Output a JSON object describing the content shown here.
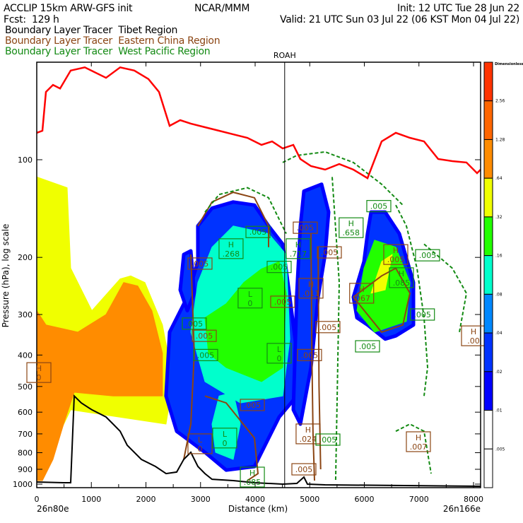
{
  "header": {
    "model": "ACCLIP 15km ARW-GFS init",
    "org": "NCAR/MMM",
    "init": "Init: 12 UTC Tue 28 Jun 22",
    "fcst": "Fcst:  129 h",
    "valid": "Valid: 21 UTC Sun 03 Jul 22 (06 KST Mon 04 Jul 22)",
    "legend": [
      {
        "label": "Boundary Layer Tracer  Tibet Region",
        "color": "#000000"
      },
      {
        "label": "Boundary Layer Tracer  Eastern China Region",
        "color": "#8B4513"
      },
      {
        "label": "Boundary Layer Tracer  West Pacific Region",
        "color": "#138a13"
      }
    ]
  },
  "chart_data": {
    "type": "cross-section",
    "xlabel": "Distance (km)",
    "ylabel": "Pressure (hPa), log scale",
    "xlim": [
      0,
      8140
    ],
    "ylim": [
      1025,
      50
    ],
    "x_ticks": [
      0,
      1000,
      2000,
      3000,
      4000,
      5000,
      6000,
      7000,
      8000
    ],
    "x_minor_ticks": [
      500,
      1500,
      2500,
      3500,
      4500,
      5500,
      6500,
      7500
    ],
    "y_ticks": [
      100,
      200,
      300,
      400,
      500,
      600,
      700,
      800,
      900,
      1000
    ],
    "left_endpoint": "26n80e",
    "right_endpoint": "26n166e",
    "marker": {
      "label": "ROAH",
      "x": 4541
    },
    "colorbar": {
      "title": "Dimensionless",
      "colors": [
        "#FF3300",
        "#FF6600",
        "#FF8C00",
        "#F0FF00",
        "#22FF00",
        "#00FFCC",
        "#0088FF",
        "#0033FF",
        "#0000FF",
        "#FFFFFF",
        "#FFFFFF"
      ],
      "labels": [
        "2.56",
        "1.28",
        ".64",
        ".32",
        ".16",
        ".08",
        ".04",
        ".02",
        ".01",
        ".005"
      ]
    },
    "tropopause_line": {
      "color": "#FF0000",
      "x": [
        0,
        104,
        168,
        298,
        427,
        621,
        880,
        1269,
        1528,
        1786,
        2045,
        2239,
        2434,
        2628,
        2822,
        3081,
        3340,
        3599,
        3858,
        4117,
        4311,
        4505,
        4699,
        4828,
        5023,
        5282,
        5540,
        5799,
        6058,
        6317,
        6576,
        6835,
        7094,
        7353,
        7612,
        7871,
        8065,
        8129
      ],
      "p": [
        82.6,
        81.4,
        61.8,
        58.8,
        60.3,
        53.1,
        51.9,
        55.9,
        51.9,
        53.1,
        56.4,
        61.8,
        78.6,
        75.5,
        77.4,
        79.4,
        81.4,
        83.5,
        85.6,
        90.0,
        87.8,
        92.3,
        90.0,
        99.5,
        104.6,
        107.3,
        103.1,
        107.3,
        114,
        87.8,
        82.6,
        85.6,
        87.8,
        99.5,
        101,
        102,
        110,
        107.3
      ]
    },
    "terrain": {
      "color": "#000000",
      "x": [
        0,
        492,
        621,
        686,
        816,
        1010,
        1269,
        1398,
        1528,
        1657,
        1916,
        2175,
        2369,
        2563,
        2693,
        2822,
        2951,
        3081,
        3210,
        3599,
        3987,
        4505,
        4764,
        4893,
        4958,
        5282,
        8129
      ],
      "p": [
        985,
        990,
        990,
        535,
        562,
        590,
        621,
        653,
        687,
        759,
        839,
        882,
        928,
        918,
        839,
        798,
        882,
        928,
        966,
        975,
        990,
        1000,
        995,
        951,
        1000,
        1005,
        1015
      ]
    },
    "shaded": [
      {
        "level": ".32",
        "color": "#F0FF00",
        "x": [
          0,
          556,
          621,
          1010,
          1527,
          1721,
          1980,
          2303,
          2497,
          2368,
          621,
          0
        ],
        "p": [
          113,
          122,
          216,
          292,
          233,
          228,
          239,
          323,
          483,
          653,
          590,
          975
        ]
      },
      {
        "level": ".64",
        "color": "#FF8C00",
        "x": [
          0,
          168,
          751,
          1268,
          1592,
          1850,
          2109,
          2303,
          2303,
          1398,
          686,
          492,
          298,
          104,
          0
        ],
        "p": [
          292,
          323,
          340,
          300,
          239,
          245,
          292,
          395,
          535,
          535,
          521,
          653,
          839,
          975,
          975
        ]
      },
      {
        "level": ".02",
        "color": "#0033FF",
        "x": [
          2950,
          3210,
          3599,
          3987,
          4246,
          4505,
          4635,
          4764,
          4764,
          4440,
          3987,
          3469,
          3081,
          2563,
          2368,
          2434,
          2757,
          2951
        ],
        "p": [
          160,
          141,
          135,
          138,
          160,
          182,
          265,
          395,
          535,
          621,
          883,
          905,
          798,
          687,
          535,
          340,
          265,
          206
        ]
      },
      {
        "level": ".02",
        "color": "#0033FF",
        "x": [
          4893,
          5217,
          5346,
          5282,
          5153,
          5023,
          4828,
          4699,
          4764,
          4828
        ],
        "p": [
          125,
          119,
          145,
          196,
          265,
          437,
          653,
          590,
          258,
          160
        ]
      },
      {
        "level": ".02",
        "color": "#0033FF",
        "x": [
          6123,
          6382,
          6641,
          6900,
          6900,
          6576,
          6382,
          6058,
          5864,
          5799,
          5994,
          6058
        ],
        "p": [
          145,
          145,
          169,
          239,
          323,
          349,
          357,
          323,
          307,
          265,
          206,
          169
        ]
      },
      {
        "level": ".02",
        "color": "#0033FF",
        "x": [
          2692,
          2822,
          2886,
          2757,
          2628
        ],
        "p": [
          196,
          191,
          258,
          292,
          252
        ]
      },
      {
        "level": ".08",
        "color": "#00FFCC",
        "x": [
          3210,
          3599,
          4246,
          4570,
          4635,
          4505,
          3728,
          3081,
          2822,
          2951
        ],
        "p": [
          186,
          160,
          169,
          196,
          357,
          535,
          562,
          483,
          340,
          239
        ]
      },
      {
        "level": ".08",
        "color": "#00FFCC",
        "x": [
          3340,
          3599,
          3728,
          3599,
          3275,
          3210
        ],
        "p": [
          535,
          521,
          653,
          839,
          798,
          653
        ]
      },
      {
        "level": ".16",
        "color": "#22FF00",
        "x": [
          3469,
          3793,
          4117,
          4440,
          4570,
          4505,
          4117,
          3469,
          3146,
          3081
        ],
        "p": [
          278,
          239,
          217,
          206,
          258,
          437,
          483,
          437,
          395,
          307
        ]
      },
      {
        "level": ".16",
        "color": "#22FF00",
        "x": [
          6188,
          6576,
          6835,
          6770,
          6188,
          5864,
          5994
        ],
        "p": [
          177,
          186,
          239,
          315,
          340,
          292,
          216
        ]
      },
      {
        "level": ".32",
        "color": "#F0FF00",
        "x": [
          6317,
          6511,
          6382,
          6123
        ],
        "p": [
          206,
          196,
          252,
          258
        ]
      }
    ],
    "east_china_contours": [
      {
        "x": [
          2950,
          3210,
          3599,
          3987,
          4246,
          4246
        ],
        "p": [
          160,
          135,
          126,
          131,
          160,
          186
        ]
      },
      {
        "x": [
          5023,
          5040,
          5060,
          5088
        ],
        "p": [
          169,
          400,
          700,
          975
        ]
      },
      {
        "x": [
          5153,
          5170,
          5200
        ],
        "p": [
          186,
          500,
          900
        ]
      },
      {
        "x": [
          3081,
          3469,
          3987,
          4052,
          3858
        ],
        "p": [
          535,
          562,
          721,
          928,
          975
        ]
      },
      {
        "x": [
          5799,
          6317,
          6576,
          6835,
          6706,
          6317,
          5799
        ],
        "p": [
          265,
          228,
          216,
          258,
          323,
          340,
          265
        ]
      },
      {
        "x": [
          2822,
          2886,
          2822,
          2693
        ],
        "p": [
          196,
          395,
          653,
          839
        ]
      }
    ],
    "west_pacific_contours": [
      {
        "x": [
          4505,
          4764,
          5282,
          5799,
          6317,
          6705
        ],
        "p": [
          102,
          97,
          94.6,
          102,
          119,
          138
        ]
      },
      {
        "x": [
          6576,
          6770,
          6964,
          7094,
          7158,
          7094
        ],
        "p": [
          138,
          160,
          216,
          307,
          437,
          535
        ]
      },
      {
        "x": [
          7094,
          7612,
          7871,
          7741
        ],
        "p": [
          182,
          216,
          258,
          340
        ]
      },
      {
        "x": [
          3081,
          3340,
          3858,
          4246,
          4570
        ],
        "p": [
          145,
          128,
          122,
          131,
          169
        ]
      },
      {
        "x": [
          6576,
          6835,
          7094,
          7223
        ],
        "p": [
          687,
          653,
          687,
          928
        ]
      },
      {
        "x": [
          5411,
          5540,
          5475
        ],
        "p": [
          113,
          239,
          975
        ]
      }
    ],
    "contour_labels": [
      {
        "text": ".005",
        "series": "west_pacific",
        "x": 4052,
        "p": 167
      },
      {
        "text": "H .268",
        "series": "west_pacific",
        "x": 3559,
        "p": 188
      },
      {
        "text": ".005",
        "series": "east_china",
        "x": 2990,
        "p": 209
      },
      {
        "text": ".005",
        "series": "west_pacific",
        "x": 2886,
        "p": 320
      },
      {
        "text": ".005",
        "series": "east_china",
        "x": 3068,
        "p": 349
      },
      {
        "text": ".005",
        "series": "west_pacific",
        "x": 3094,
        "p": 400
      },
      {
        "text": "L 0",
        "series": "west_pacific",
        "x": 3908,
        "p": 267
      },
      {
        "text": ".005",
        "series": "west_pacific",
        "x": 4440,
        "p": 214
      },
      {
        "text": ".005",
        "series": "east_china",
        "x": 4505,
        "p": 274
      },
      {
        "text": "L 0",
        "series": "west_pacific",
        "x": 4440,
        "p": 395
      },
      {
        "text": ".005",
        "series": "east_china",
        "x": 4918,
        "p": 162
      },
      {
        "text": "H .717",
        "series": "west_pacific",
        "x": 4789,
        "p": 188
      },
      {
        "text": ".005",
        "series": "east_china",
        "x": 5359,
        "p": 193
      },
      {
        "text": "H .011",
        "series": "east_china",
        "x": 5023,
        "p": 249
      },
      {
        "text": ".005",
        "series": "east_china",
        "x": 5333,
        "p": 328
      },
      {
        "text": ".005",
        "series": "east_china",
        "x": 4996,
        "p": 400
      },
      {
        "text": "H .658",
        "series": "west_pacific",
        "x": 5758,
        "p": 162
      },
      {
        "text": ".005",
        "series": "west_pacific",
        "x": 6265,
        "p": 139
      },
      {
        "text": "H .005",
        "series": "east_china",
        "x": 6576,
        "p": 196
      },
      {
        "text": "H .085",
        "series": "west_pacific",
        "x": 6679,
        "p": 231
      },
      {
        "text": "H .067",
        "series": "east_china",
        "x": 5951,
        "p": 258
      },
      {
        "text": ".005",
        "series": "west_pacific",
        "x": 7158,
        "p": 197
      },
      {
        "text": ".005",
        "series": "west_pacific",
        "x": 7064,
        "p": 300
      },
      {
        "text": ".005",
        "series": "west_pacific",
        "x": 6058,
        "p": 376
      },
      {
        "text": "H .00",
        "series": "east_china",
        "x": 8000,
        "p": 349
      },
      {
        "text": "H 0",
        "series": "east_china",
        "x": 39,
        "p": 453
      },
      {
        "text": ".005",
        "series": "east_china",
        "x": 3949,
        "p": 570
      },
      {
        "text": "L 0",
        "series": "east_china",
        "x": 2990,
        "p": 751
      },
      {
        "text": "L 0",
        "series": "west_pacific",
        "x": 3443,
        "p": 721
      },
      {
        "text": "H .085",
        "series": "west_pacific",
        "x": 3949,
        "p": 951
      },
      {
        "text": "H .024",
        "series": "east_china",
        "x": 4970,
        "p": 700
      },
      {
        "text": ".005",
        "series": "west_pacific",
        "x": 5333,
        "p": 729
      },
      {
        "text": ".005",
        "series": "east_china",
        "x": 4893,
        "p": 900
      },
      {
        "text": "H .007",
        "series": "east_china",
        "x": 6990,
        "p": 740
      }
    ],
    "series_colors": {
      "east_china": "#8B4513",
      "west_pacific": "#138a13"
    }
  }
}
